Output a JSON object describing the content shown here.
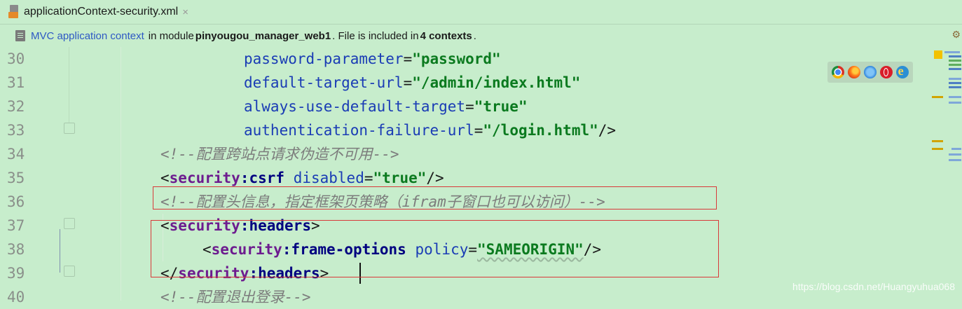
{
  "tab": {
    "title": "applicationContext-security.xml",
    "close_glyph": "×",
    "icon": "xml-file-icon"
  },
  "infobar": {
    "link": "MVC application context",
    "text1": "in module",
    "module": "pinyougou_manager_web1",
    "text2": ". File is included in",
    "contexts": "4 contexts",
    "text3": "."
  },
  "line_numbers": [
    "30",
    "31",
    "32",
    "33",
    "34",
    "35",
    "36",
    "37",
    "38",
    "39",
    "40"
  ],
  "code": {
    "l30": {
      "attr": "password-parameter",
      "eq": "=",
      "val": "\"password\""
    },
    "l31": {
      "attr": "default-target-url",
      "eq": "=",
      "val": "\"/admin/index.html\""
    },
    "l32": {
      "attr": "always-use-default-target",
      "eq": "=",
      "val": "\"true\""
    },
    "l33": {
      "attr": "authentication-failure-url",
      "eq": "=",
      "val": "\"/login.html\"",
      "close": "/>"
    },
    "l34": {
      "comment": "<!--配置跨站点请求伪造不可用-->"
    },
    "l35": {
      "open": "<",
      "ns": "security",
      "colon": ":",
      "tag": "csrf",
      "attr": "disabled",
      "eq": "=",
      "val": "\"true\"",
      "close": "/>"
    },
    "l36": {
      "comment": "<!--配置头信息，指定框架页策略（ifram子窗口也可以访问）-->"
    },
    "l37": {
      "open": "<",
      "ns": "security",
      "colon": ":",
      "tag": "headers",
      "close": ">"
    },
    "l38": {
      "open": "<",
      "ns": "security",
      "colon": ":",
      "tag": "frame-options",
      "attr": "policy",
      "eq": "=",
      "val": "\"SAMEORIGIN\"",
      "close": "/>"
    },
    "l39": {
      "open": "</",
      "ns": "security",
      "colon": ":",
      "tag": "headers",
      "close": ">"
    },
    "l40": {
      "comment": "<!--配置退出登录-->"
    }
  },
  "browser_icons": [
    "chrome-icon",
    "firefox-icon",
    "safari-icon",
    "opera-icon",
    "ie-icon"
  ],
  "watermark": "https://blog.csdn.net/Huangyuhua068",
  "colors": {
    "background": "#c7edcc",
    "highlight_box": "#d83a3a",
    "string_value": "#0b7a1f",
    "attribute": "#1a3cb5",
    "namespace": "#6d1c8f",
    "comment": "#7c7c7c",
    "link": "#2e59c4"
  }
}
